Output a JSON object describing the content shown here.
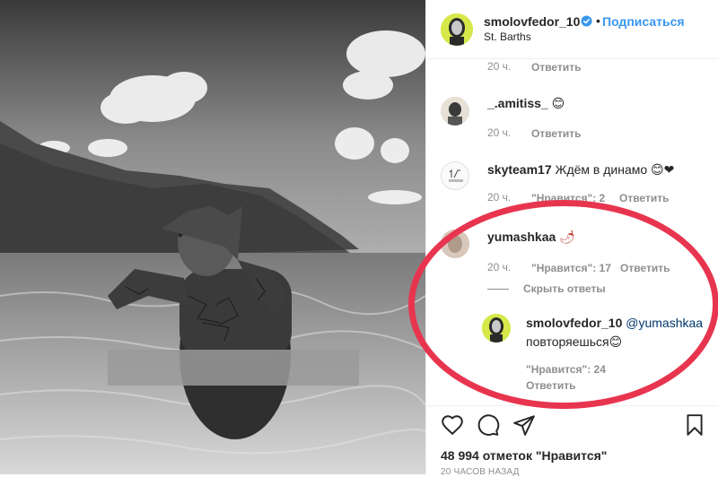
{
  "post": {
    "username": "smolovfedor_10",
    "dot": "•",
    "follow_label": "Подписаться",
    "location": "St. Barths"
  },
  "comments": [
    {
      "time": "20 ч.",
      "reply": "Ответить"
    },
    {
      "username": "_.amitiss_",
      "emoji": "😊",
      "time": "20 ч.",
      "reply": "Ответить"
    },
    {
      "username": "skyteam17",
      "text": "Ждём в динамо 😊❤",
      "time": "20 ч.",
      "likes_label": "\"Нравится\": 2",
      "reply": "Ответить"
    },
    {
      "username": "yumashkaa",
      "emoji": "🌶",
      "time": "20 ч.",
      "likes_label": "\"Нравится\": 17",
      "reply": "Ответить",
      "hide_replies": "Скрыть ответы",
      "reply_comment": {
        "username": "smolovfedor_10",
        "mention": "@yumashkaa",
        "text": "повторяешься😊",
        "likes_label": "\"Нравится\": 24",
        "reply": "Ответить"
      }
    }
  ],
  "footer": {
    "likes_text": "48 994 отметок \"Нравится\"",
    "time_ago": "20 ЧАСОВ НАЗАД"
  },
  "icons": {
    "verified": "verified-badge-icon",
    "like": "heart-icon",
    "comment": "comment-icon",
    "share": "share-icon",
    "save": "bookmark-icon"
  },
  "colors": {
    "follow": "#3897f0",
    "verified": "#3897f0",
    "highlight": "#e8354f",
    "avatar_bg": "#d6e84a",
    "muted": "#8e8e8e"
  }
}
